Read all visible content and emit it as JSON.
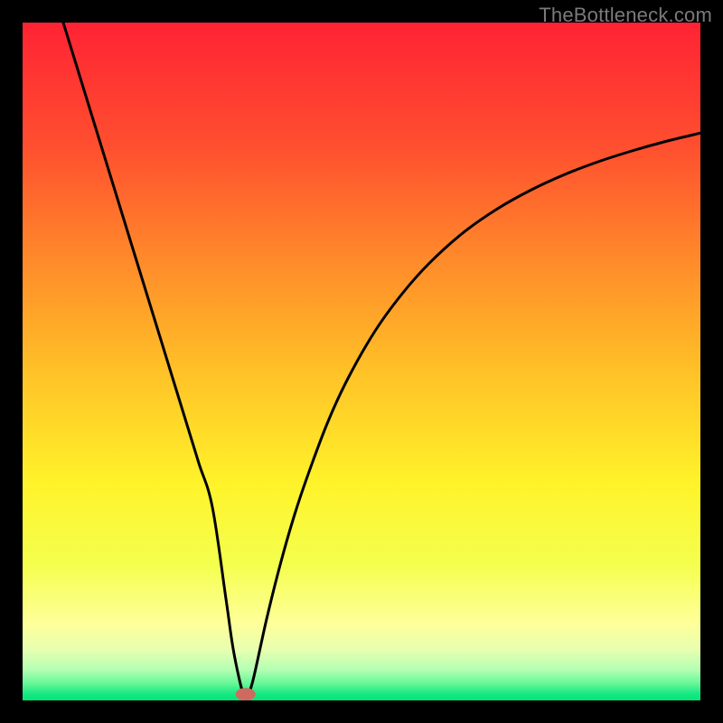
{
  "watermark": "TheBottleneck.com",
  "chart_data": {
    "type": "line",
    "title": "",
    "xlabel": "",
    "ylabel": "",
    "xlim": [
      0,
      100
    ],
    "ylim": [
      0,
      100
    ],
    "grid": false,
    "series": [
      {
        "name": "curve",
        "x": [
          6,
          8,
          10,
          12,
          14,
          16,
          18,
          20,
          22,
          24,
          26,
          28,
          30,
          31,
          32,
          32.6,
          33.2,
          34,
          36,
          38,
          40,
          42,
          45,
          48,
          52,
          56,
          60,
          65,
          70,
          75,
          80,
          85,
          90,
          95,
          100
        ],
        "y": [
          100,
          93.5,
          87,
          80.5,
          74,
          67.5,
          61,
          54.5,
          48,
          41.5,
          35,
          28.5,
          15,
          8,
          3,
          1.0,
          1.0,
          3,
          12,
          20,
          27,
          33,
          41,
          47.5,
          54.5,
          60,
          64.5,
          69,
          72.5,
          75.3,
          77.6,
          79.5,
          81.1,
          82.5,
          83.7
        ]
      }
    ],
    "marker": {
      "x": 32.9,
      "y": 0.9,
      "color": "#cf6a61"
    },
    "background_gradient": {
      "stops": [
        {
          "offset": 0.0,
          "color": "#ff2334"
        },
        {
          "offset": 0.18,
          "color": "#ff4e2f"
        },
        {
          "offset": 0.35,
          "color": "#ff8a2a"
        },
        {
          "offset": 0.52,
          "color": "#ffc327"
        },
        {
          "offset": 0.68,
          "color": "#fff32a"
        },
        {
          "offset": 0.8,
          "color": "#f4ff4e"
        },
        {
          "offset": 0.885,
          "color": "#ffff99"
        },
        {
          "offset": 0.925,
          "color": "#e8ffb0"
        },
        {
          "offset": 0.955,
          "color": "#b3ffb3"
        },
        {
          "offset": 0.975,
          "color": "#66f797"
        },
        {
          "offset": 0.99,
          "color": "#18e884"
        },
        {
          "offset": 1.0,
          "color": "#00e676"
        }
      ]
    }
  }
}
